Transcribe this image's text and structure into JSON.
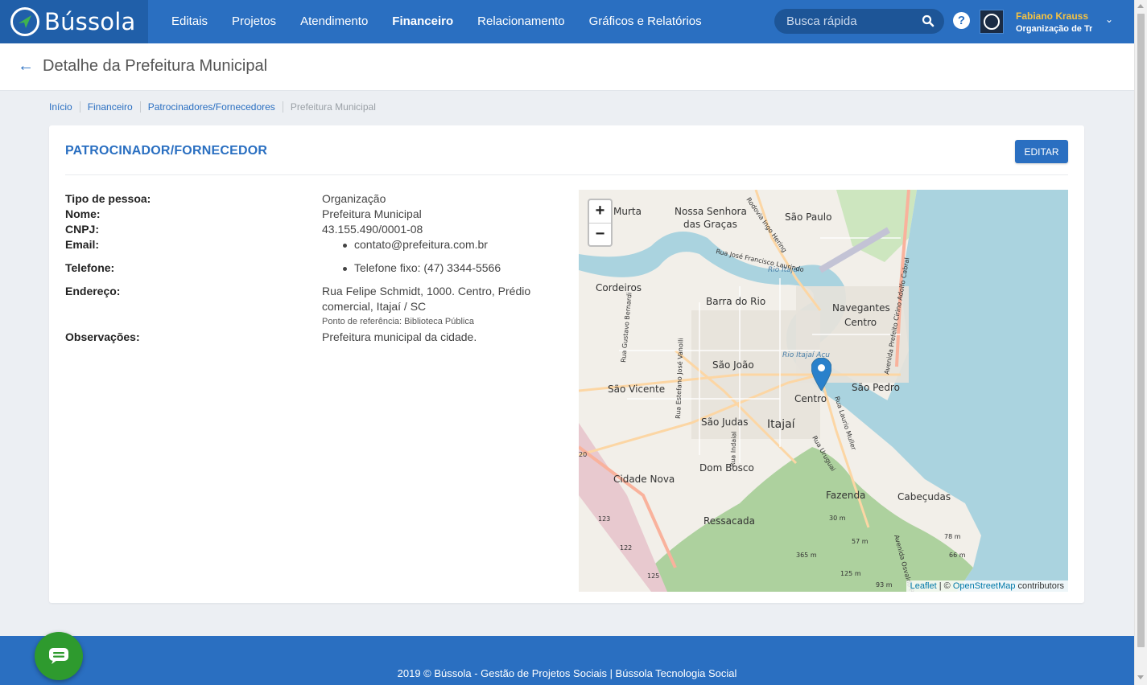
{
  "brand": {
    "name": "Bússola"
  },
  "nav": {
    "items": [
      {
        "label": "Editais",
        "active": false
      },
      {
        "label": "Projetos",
        "active": false
      },
      {
        "label": "Atendimento",
        "active": false
      },
      {
        "label": "Financeiro",
        "active": true
      },
      {
        "label": "Relacionamento",
        "active": false
      },
      {
        "label": "Gráficos e Relatórios",
        "active": false
      }
    ],
    "search_placeholder": "Busca rápida",
    "help_label": "?",
    "user": {
      "name": "Fabiano Krauss",
      "org": "Organização de Tre"
    }
  },
  "page": {
    "title": "Detalhe da Prefeitura Municipal"
  },
  "breadcrumb": [
    "Início",
    "Financeiro",
    "Patrocinadores/Fornecedores",
    "Prefeitura Municipal"
  ],
  "card": {
    "title": "PATROCINADOR/FORNECEDOR",
    "edit_label": "EDITAR",
    "fields": {
      "tipo": {
        "label": "Tipo de pessoa:",
        "value": "Organização"
      },
      "nome": {
        "label": "Nome:",
        "value": "Prefeitura Municipal"
      },
      "cnpj": {
        "label": "CNPJ:",
        "value": "43.155.490/0001-08"
      },
      "email": {
        "label": "Email:",
        "value": "contato@prefeitura.com.br"
      },
      "telefone": {
        "label": "Telefone:",
        "value": "Telefone fixo: (47) 3344-5566"
      },
      "endereco": {
        "label": "Endereço:",
        "value": "Rua Felipe Schmidt, 1000. Centro, Prédio comercial, Itajaí / SC",
        "reference": "Ponto de referência: Biblioteca Pública"
      },
      "observacoes": {
        "label": "Observações:",
        "value": "Prefeitura municipal da cidade."
      }
    }
  },
  "map": {
    "zoom_in": "+",
    "zoom_out": "−",
    "attribution_leaflet": "Leaflet",
    "attribution_sep": " | © ",
    "attribution_osm": "OpenStreetMap",
    "attribution_rest": " contributors",
    "labels": [
      "Murta",
      "Nossa Senhora",
      "das Graças",
      "São Paulo",
      "Cordeiros",
      "Barra do Rio",
      "Navegantes",
      "Centro",
      "São João",
      "São Vicente",
      "São Pedro",
      "Centro",
      "São Judas",
      "Itajaí",
      "Dom Bosco",
      "Cidade Nova",
      "Fazenda",
      "Cabeçudas",
      "Ressacada",
      "Rio Itajaí",
      "Rio Itajaí Açu",
      "Rua José Francisco Laurindo",
      "Rodovia Ingo Hering",
      "Avenida Prefeito Cirino Adolfo Cabral",
      "Rua Gustavo Bernardi",
      "Rua Estefano José Vanolli",
      "Rua Laurio Muller",
      "Rua Uruguai",
      "Rua Indaial",
      "Avenida Osvaldo Reis",
      "30 m",
      "57 m",
      "365 m",
      "125 m",
      "93 m",
      "78 m",
      "66 m",
      "123",
      "122",
      "125",
      "20"
    ]
  },
  "footer": {
    "text": "2019 © Bússola - Gestão de Projetos Sociais  |  Bússola Tecnologia Social"
  }
}
